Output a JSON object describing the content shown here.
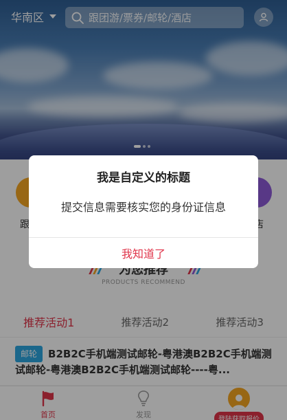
{
  "header": {
    "region": "华南区",
    "search_placeholder": "跟团游/票券/邮轮/酒店"
  },
  "categories": {
    "left_partial_label": "跟",
    "right_partial_label": "店"
  },
  "recommend": {
    "title": "为您推荐",
    "subtitle": "PRODUCTS RECOMMEND",
    "tabs": [
      {
        "label": "推荐活动1",
        "active": true
      },
      {
        "label": "推荐活动2",
        "active": false
      },
      {
        "label": "推荐活动3",
        "active": false
      }
    ]
  },
  "list": [
    {
      "tag": "邮轮",
      "text": "B2B2C手机端测试邮轮-粤港澳B2B2C手机端测试邮轮-粤港澳B2B2C手机端测试邮轮----粤..."
    }
  ],
  "bottom_nav": {
    "home": "首页",
    "discover": "发现",
    "login": "登陆获取报价"
  },
  "dialog": {
    "title": "我是自定义的标题",
    "message": "提交信息需要核实您的身份证信息",
    "confirm": "我知道了"
  },
  "colors": {
    "accent": "#e0344a",
    "tag": "#2ca6e0"
  }
}
